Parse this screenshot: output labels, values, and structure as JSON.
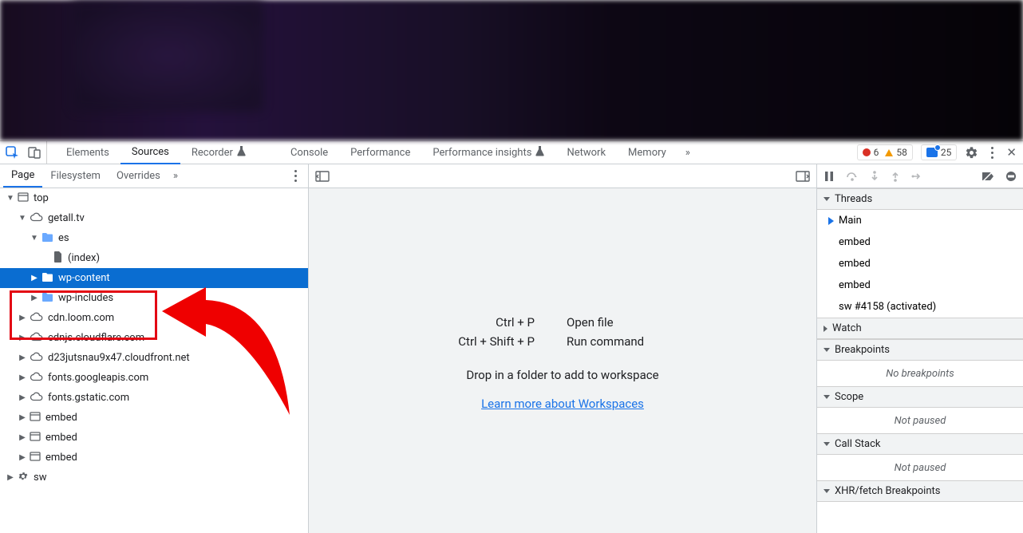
{
  "toolbar": {
    "tabs": [
      "Elements",
      "Sources",
      "Recorder",
      "Console",
      "Performance",
      "Performance insights",
      "Network",
      "Memory"
    ],
    "active_tab": "Sources",
    "experiment_indices": [
      2,
      5
    ],
    "errors_count": "6",
    "warnings_count": "58",
    "messages_count": "25"
  },
  "left": {
    "sub_tabs": [
      "Page",
      "Filesystem",
      "Overrides"
    ],
    "active_sub_tab": "Page",
    "tree": [
      {
        "depth": 0,
        "expanded": true,
        "icon": "frame",
        "label": "top"
      },
      {
        "depth": 1,
        "expanded": true,
        "icon": "cloud",
        "label": "getall.tv"
      },
      {
        "depth": 2,
        "expanded": true,
        "icon": "folder",
        "label": "es"
      },
      {
        "depth": 3,
        "expanded": null,
        "icon": "file",
        "label": "(index)"
      },
      {
        "depth": 2,
        "expanded": false,
        "icon": "folder",
        "label": "wp-content",
        "selected": true
      },
      {
        "depth": 2,
        "expanded": false,
        "icon": "folder",
        "label": "wp-includes"
      },
      {
        "depth": 1,
        "expanded": false,
        "icon": "cloud",
        "label": "cdn.loom.com"
      },
      {
        "depth": 1,
        "expanded": false,
        "icon": "cloud",
        "label": "cdnjs.cloudflare.com"
      },
      {
        "depth": 1,
        "expanded": false,
        "icon": "cloud",
        "label": "d23jutsnau9x47.cloudfront.net"
      },
      {
        "depth": 1,
        "expanded": false,
        "icon": "cloud",
        "label": "fonts.googleapis.com"
      },
      {
        "depth": 1,
        "expanded": false,
        "icon": "cloud",
        "label": "fonts.gstatic.com"
      },
      {
        "depth": 1,
        "expanded": false,
        "icon": "frame",
        "label": "embed"
      },
      {
        "depth": 1,
        "expanded": false,
        "icon": "frame",
        "label": "embed"
      },
      {
        "depth": 1,
        "expanded": false,
        "icon": "frame",
        "label": "embed"
      },
      {
        "depth": 0,
        "expanded": false,
        "icon": "gear",
        "label": "sw"
      }
    ]
  },
  "center": {
    "rows": [
      {
        "shortcut": "Ctrl + P",
        "action": "Open file"
      },
      {
        "shortcut": "Ctrl + Shift + P",
        "action": "Run command"
      }
    ],
    "drop_text": "Drop in a folder to add to workspace",
    "learn_link": "Learn more about Workspaces"
  },
  "right": {
    "sections": {
      "threads": {
        "title": "Threads",
        "items": [
          "Main",
          "embed",
          "embed",
          "embed",
          "sw #4158 (activated)"
        ]
      },
      "watch": {
        "title": "Watch"
      },
      "breakpoints": {
        "title": "Breakpoints",
        "empty": "No breakpoints"
      },
      "scope": {
        "title": "Scope",
        "empty": "Not paused"
      },
      "callstack": {
        "title": "Call Stack",
        "empty": "Not paused"
      },
      "xhr": {
        "title": "XHR/fetch Breakpoints"
      }
    }
  }
}
